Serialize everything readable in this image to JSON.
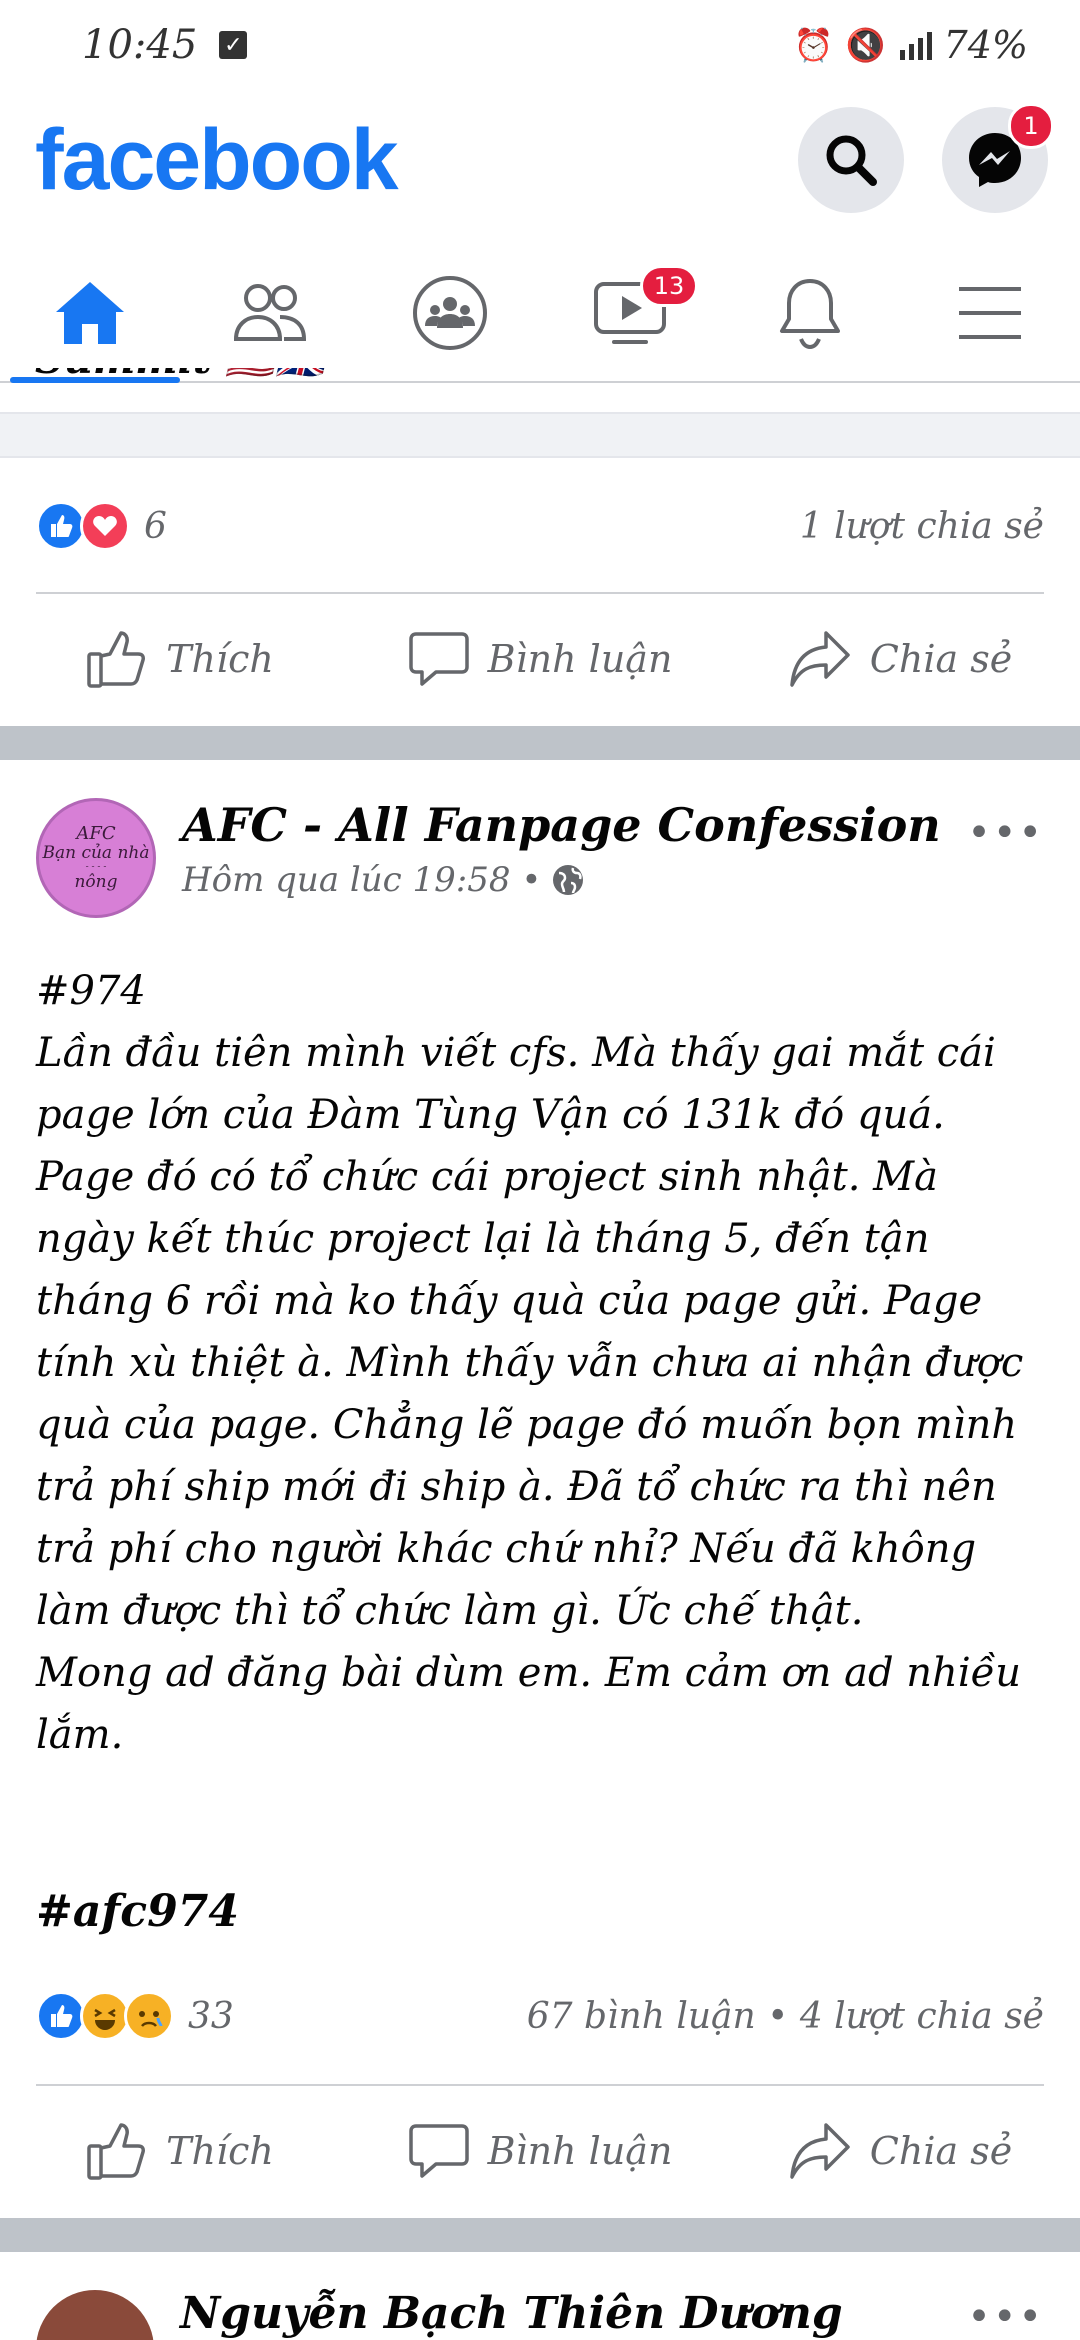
{
  "status_bar": {
    "time": "10:45",
    "battery": "74%"
  },
  "header": {
    "logo": "facebook",
    "messenger_badge": "1"
  },
  "tabs": [
    {
      "name": "home",
      "active": true
    },
    {
      "name": "friends"
    },
    {
      "name": "groups"
    },
    {
      "name": "watch",
      "badge": "13"
    },
    {
      "name": "notifications"
    },
    {
      "name": "menu"
    }
  ],
  "previous_post": {
    "title_fragment": "Summit",
    "flags": "🇺🇸🇬🇧",
    "reaction_count": "6",
    "shares": "1 lượt chia sẻ"
  },
  "actions": {
    "like": "Thích",
    "comment": "Bình luận",
    "share": "Chia sẻ"
  },
  "post": {
    "avatar_text": [
      "AFC",
      "Bạn của nhà",
      "nông"
    ],
    "page_name": "AFC - All Fanpage Confession",
    "time": "Hôm qua lúc 19:58 •",
    "number": "#974",
    "body": [
      " Lần đầu tiên mình viết cfs. Mà thấy gai mắt cái page lớn của Đàm Tùng Vận có 131k đó quá. Page đó có tổ chức cái project sinh nhật. Mà ngày kết thúc project lại là tháng 5, đến tận tháng 6 rồi mà ko thấy quà của page gửi. Page tính xù thiệt à. Mình thấy vẫn chưa ai nhận được quà của page. Chẳng lẽ page đó muốn bọn mình trả phí ship mới đi ship à. Đã tổ chức ra thì nên trả phí cho người khác chứ nhỉ? Nếu đã không làm được thì tổ chức làm gì. Ức chế thật.",
      "Mong ad đăng bài dùm em. Em cảm ơn ad nhiều lắm."
    ],
    "hashtag": "#afc974",
    "reaction_count": "33",
    "comments_shares": "67 bình luận • 4 lượt chia sẻ"
  },
  "next_post": {
    "page_name": "Nguyễn Bạch Thiên Dương"
  },
  "colors": {
    "brand": "#1877f2",
    "badge": "#e41e3f",
    "separator": "#bec3c9"
  }
}
